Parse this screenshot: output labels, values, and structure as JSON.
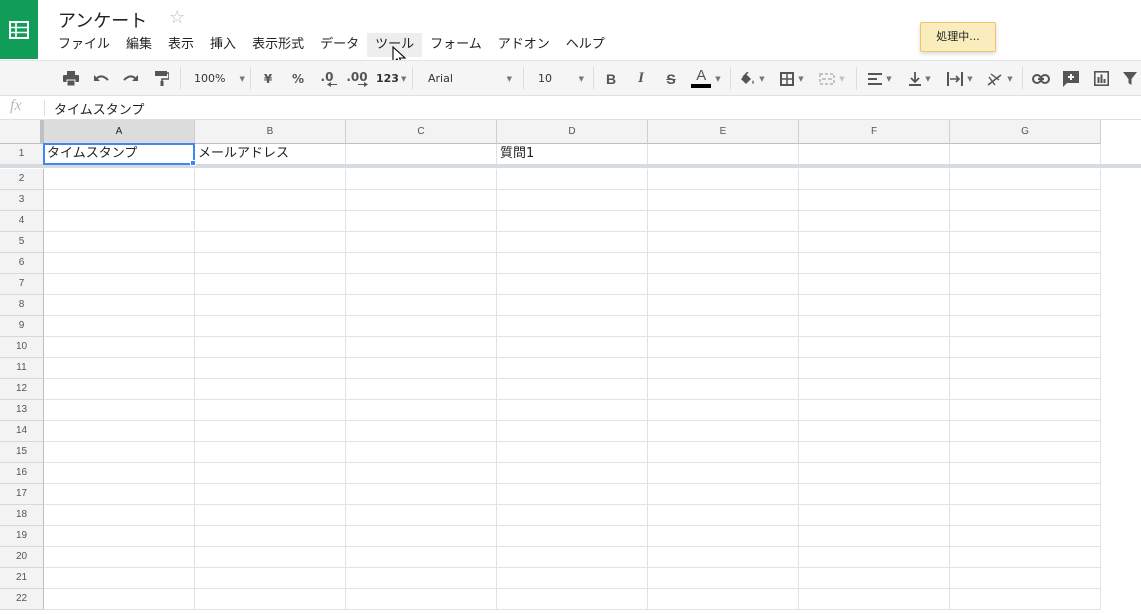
{
  "document": {
    "title": "アンケート"
  },
  "menu": [
    "ファイル",
    "編集",
    "表示",
    "挿入",
    "表示形式",
    "データ",
    "ツール",
    "フォーム",
    "アドオン",
    "ヘルプ"
  ],
  "status": {
    "processing": "処理中..."
  },
  "toolbar": {
    "zoom": "100%",
    "currency": "¥",
    "percent": "%",
    "decimal_decrease": ".0",
    "decimal_increase": ".00",
    "number_format": "123",
    "font": "Arial",
    "font_size": "10",
    "bold": "B",
    "italic": "I",
    "strike": "S",
    "text_color_letter": "A",
    "text_color": "#000000"
  },
  "formula_bar": {
    "label": "fx",
    "value": "タイムスタンプ"
  },
  "grid": {
    "columns": [
      "A",
      "B",
      "C",
      "D",
      "E",
      "F",
      "G"
    ],
    "selected_column": "A",
    "rows": [
      "1",
      "2",
      "3",
      "4",
      "5",
      "6",
      "7",
      "8",
      "9",
      "10",
      "11",
      "12",
      "13",
      "14",
      "15",
      "16",
      "17",
      "18",
      "19",
      "20",
      "21",
      "22"
    ],
    "cells": {
      "A1": "タイムスタンプ",
      "B1": "メールアドレス",
      "D1": "質問1"
    }
  },
  "colors": {
    "brand": "#0f9d58",
    "selection": "#4285f4",
    "processing_bg": "#f9edbe"
  }
}
